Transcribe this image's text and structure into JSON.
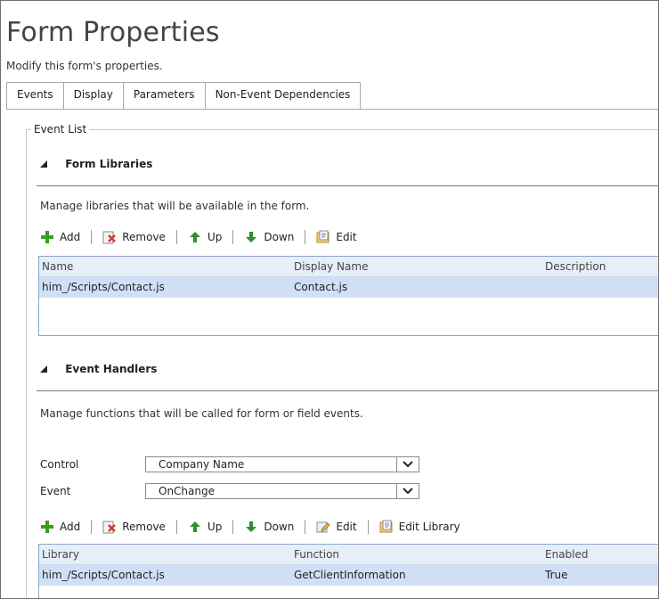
{
  "page": {
    "title": "Form Properties",
    "subtitle": "Modify this form's properties."
  },
  "tabs": [
    {
      "label": "Events"
    },
    {
      "label": "Display"
    },
    {
      "label": "Parameters"
    },
    {
      "label": "Non-Event Dependencies"
    }
  ],
  "event_list": {
    "legend": "Event List",
    "form_libraries": {
      "heading": "Form Libraries",
      "description": "Manage libraries that will be available in the form.",
      "toolbar": {
        "add": "Add",
        "remove": "Remove",
        "up": "Up",
        "down": "Down",
        "edit": "Edit"
      },
      "columns": [
        "Name",
        "Display Name",
        "Description"
      ],
      "rows": [
        {
          "name": "him_/Scripts/Contact.js",
          "display_name": "Contact.js",
          "description": ""
        }
      ]
    },
    "event_handlers": {
      "heading": "Event Handlers",
      "description": "Manage functions that will be called for form or field events.",
      "control_label": "Control",
      "control_value": "Company Name",
      "event_label": "Event",
      "event_value": "OnChange",
      "toolbar": {
        "add": "Add",
        "remove": "Remove",
        "up": "Up",
        "down": "Down",
        "edit": "Edit",
        "edit_library": "Edit Library"
      },
      "columns": [
        "Library",
        "Function",
        "Enabled"
      ],
      "rows": [
        {
          "library": "him_/Scripts/Contact.js",
          "function": "GetClientInformation",
          "enabled": "True"
        }
      ]
    }
  },
  "colors": {
    "selected_row": "#cfe0f6",
    "grid_header": "#e6eef8",
    "add_icon": "#3a9d23",
    "arrow_icon": "#2f8f2f"
  }
}
